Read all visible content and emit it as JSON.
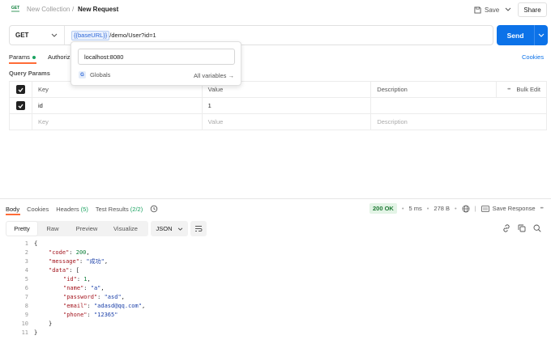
{
  "header": {
    "collection": "New Collection",
    "separator": "/",
    "request_name": "New Request",
    "save_label": "Save",
    "share_label": "Share",
    "logo_text": "GET"
  },
  "url_bar": {
    "method": "GET",
    "variable": "{{baseURL}}",
    "path": "/demo/User?id=1",
    "send_label": "Send"
  },
  "popover": {
    "value": "localhost:8080",
    "scope_badge": "G",
    "scope_label": "Globals",
    "all_vars_label": "All variables →"
  },
  "request_tabs": {
    "params": "Params",
    "authorization": "Authoriz",
    "cookies": "Cookies"
  },
  "query": {
    "title": "Query Params",
    "headers": {
      "key": "Key",
      "value": "Value",
      "description": "Description",
      "bulk_edit": "Bulk Edit",
      "more": "•••"
    },
    "rows": [
      {
        "key": "id",
        "value": "1",
        "description": ""
      }
    ],
    "placeholder": {
      "key": "Key",
      "value": "Value",
      "description": "Description"
    }
  },
  "response": {
    "tabs": {
      "body": "Body",
      "cookies": "Cookies",
      "headers": "Headers",
      "headers_count": "(5)",
      "tests": "Test Results",
      "tests_count": "(2/2)"
    },
    "status": "200 OK",
    "time": "5 ms",
    "size": "278 B",
    "save_response": "Save Response",
    "views": {
      "pretty": "Pretty",
      "raw": "Raw",
      "preview": "Preview",
      "visualize": "Visualize"
    },
    "format": "JSON",
    "lines": [
      {
        "n": "1",
        "indent": 0,
        "parts": [
          [
            "p",
            "{"
          ]
        ]
      },
      {
        "n": "2",
        "indent": 1,
        "parts": [
          [
            "k",
            "\"code\""
          ],
          [
            "p",
            ": "
          ],
          [
            "n",
            "200"
          ],
          [
            "p",
            ","
          ]
        ]
      },
      {
        "n": "3",
        "indent": 1,
        "parts": [
          [
            "k",
            "\"message\""
          ],
          [
            "p",
            ": "
          ],
          [
            "s",
            "\"成功\""
          ],
          [
            "p",
            ","
          ]
        ]
      },
      {
        "n": "4",
        "indent": 1,
        "parts": [
          [
            "k",
            "\"data\""
          ],
          [
            "p",
            ": ["
          ]
        ]
      },
      {
        "n": "5",
        "indent": 2,
        "parts": [
          [
            "k",
            "\"id\""
          ],
          [
            "p",
            ": "
          ],
          [
            "n",
            "1"
          ],
          [
            "p",
            ","
          ]
        ]
      },
      {
        "n": "6",
        "indent": 2,
        "parts": [
          [
            "k",
            "\"name\""
          ],
          [
            "p",
            ": "
          ],
          [
            "s",
            "\"a\""
          ],
          [
            "p",
            ","
          ]
        ]
      },
      {
        "n": "7",
        "indent": 2,
        "parts": [
          [
            "k",
            "\"password\""
          ],
          [
            "p",
            ": "
          ],
          [
            "s",
            "\"asd\""
          ],
          [
            "p",
            ","
          ]
        ]
      },
      {
        "n": "8",
        "indent": 2,
        "parts": [
          [
            "k",
            "\"email\""
          ],
          [
            "p",
            ": "
          ],
          [
            "s",
            "\"adasd@qq.com\""
          ],
          [
            "p",
            ","
          ]
        ]
      },
      {
        "n": "9",
        "indent": 2,
        "parts": [
          [
            "k",
            "\"phone\""
          ],
          [
            "p",
            ": "
          ],
          [
            "s",
            "\"12365\""
          ]
        ]
      },
      {
        "n": "10",
        "indent": 1,
        "parts": [
          [
            "p",
            "}"
          ]
        ]
      },
      {
        "n": "11",
        "indent": 0,
        "parts": [
          [
            "p",
            "}"
          ]
        ]
      }
    ]
  },
  "colors": {
    "accent": "#0c72e8",
    "status_ok_bg": "#e3f4e6",
    "status_ok_text": "#1f7a35",
    "param_dot": "#1aa260",
    "json_key": "#a3151e",
    "json_string": "#1a3fa8",
    "json_number": "#0d7f3a"
  }
}
